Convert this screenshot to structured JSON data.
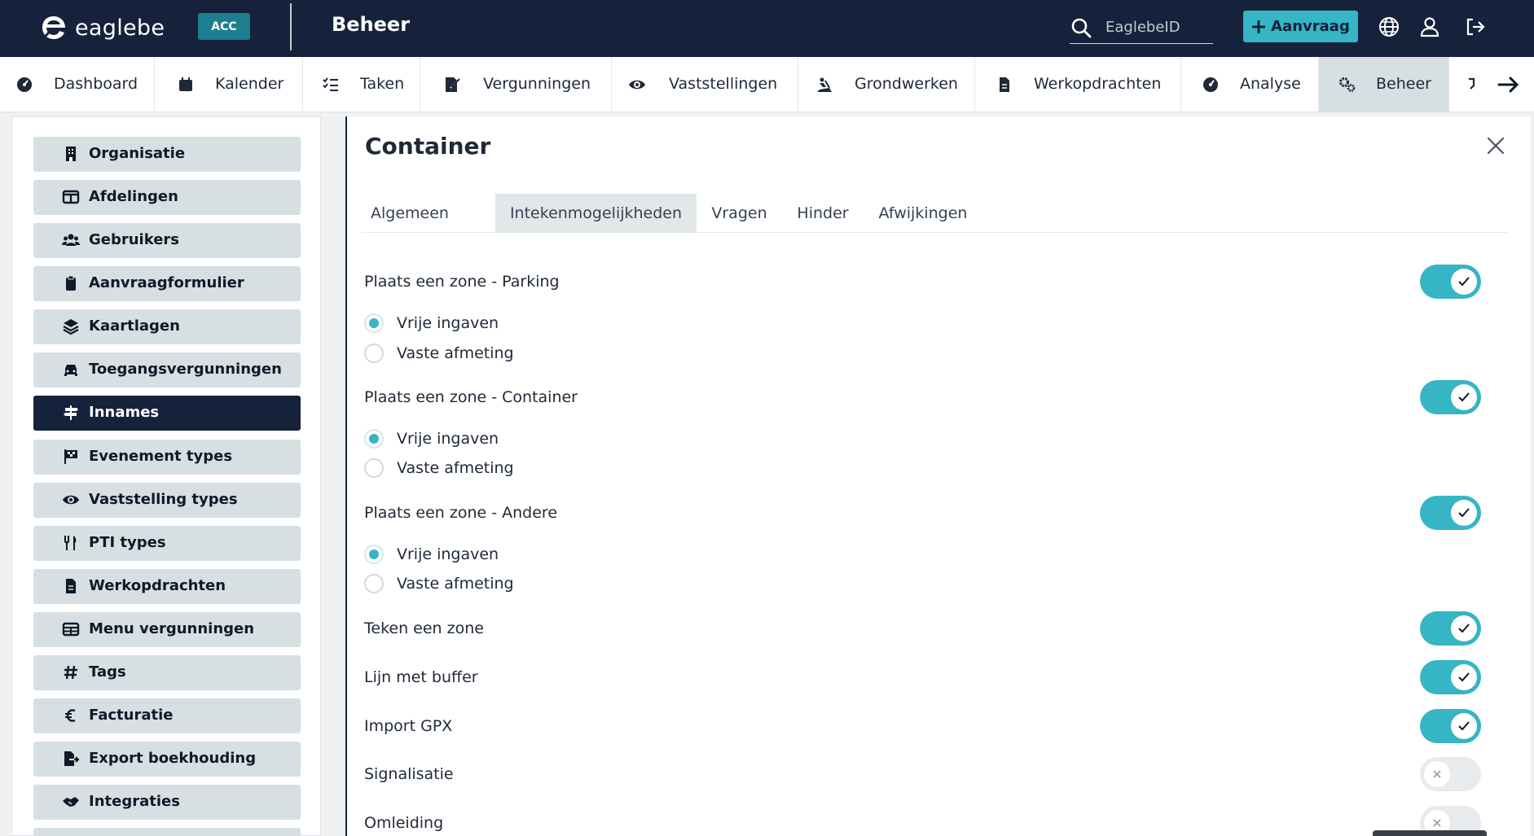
{
  "topbar": {
    "logo_text": "eaglebe",
    "env_badge": "ACC",
    "app_title": "Beheer",
    "search_placeholder": "EaglebeID",
    "aanvraag_label": "Aanvraag"
  },
  "nav": {
    "items": [
      {
        "label": "Dashboard",
        "icon": "dashboard-icon"
      },
      {
        "label": "Kalender",
        "icon": "calendar-icon"
      },
      {
        "label": "Taken",
        "icon": "tasks-icon"
      },
      {
        "label": "Vergunningen",
        "icon": "permit-icon"
      },
      {
        "label": "Vaststellingen",
        "icon": "eye-icon"
      },
      {
        "label": "Grondwerken",
        "icon": "digging-icon"
      },
      {
        "label": "Werkopdrachten",
        "icon": "document-icon"
      },
      {
        "label": "Analyse",
        "icon": "analysis-icon"
      },
      {
        "label": "Beheer",
        "icon": "gears-icon"
      }
    ],
    "active": "Beheer"
  },
  "sidebar": {
    "items": [
      {
        "label": "Organisatie",
        "icon": "building-icon"
      },
      {
        "label": "Afdelingen",
        "icon": "columns-icon"
      },
      {
        "label": "Gebruikers",
        "icon": "users-icon"
      },
      {
        "label": "Aanvraagformulier",
        "icon": "clipboard-icon"
      },
      {
        "label": "Kaartlagen",
        "icon": "layers-icon"
      },
      {
        "label": "Toegangsvergunningen",
        "icon": "car-icon"
      },
      {
        "label": "Innames",
        "icon": "signpost-icon"
      },
      {
        "label": "Evenement types",
        "icon": "flag-icon"
      },
      {
        "label": "Vaststelling types",
        "icon": "eye-icon"
      },
      {
        "label": "PTI types",
        "icon": "utensils-icon"
      },
      {
        "label": "Werkopdrachten",
        "icon": "file-icon"
      },
      {
        "label": "Menu vergunningen",
        "icon": "table-icon"
      },
      {
        "label": "Tags",
        "icon": "hashtag-icon"
      },
      {
        "label": "Facturatie",
        "icon": "euro-icon"
      },
      {
        "label": "Export boekhouding",
        "icon": "file-export-icon"
      },
      {
        "label": "Integraties",
        "icon": "handshake-icon"
      }
    ],
    "active": "Innames"
  },
  "panel": {
    "title": "Container",
    "tabs": [
      "Algemeen",
      "Intekenmogelijkheden",
      "Vragen",
      "Hinder",
      "Afwijkingen"
    ],
    "active_tab": "Intekenmogelijkheden",
    "zones": [
      {
        "label": "Plaats een zone - Parking",
        "enabled": true,
        "options": [
          "Vrije ingaven",
          "Vaste afmeting"
        ],
        "selected": "Vrije ingaven"
      },
      {
        "label": "Plaats een zone - Container",
        "enabled": true,
        "options": [
          "Vrije ingaven",
          "Vaste afmeting"
        ],
        "selected": "Vrije ingaven"
      },
      {
        "label": "Plaats een zone - Andere",
        "enabled": true,
        "options": [
          "Vrije ingaven",
          "Vaste afmeting"
        ],
        "selected": "Vrije ingaven"
      }
    ],
    "toggles": [
      {
        "label": "Teken een zone",
        "enabled": true
      },
      {
        "label": "Lijn met buffer",
        "enabled": true
      },
      {
        "label": "Import GPX",
        "enabled": true
      },
      {
        "label": "Signalisatie",
        "enabled": false
      },
      {
        "label": "Omleiding",
        "enabled": false
      }
    ]
  },
  "colors": {
    "topbar_bg": "#16213b",
    "accent": "#36b5c4",
    "badge": "#1c7f8f",
    "sidebar_item_bg": "#d7dfe3"
  }
}
